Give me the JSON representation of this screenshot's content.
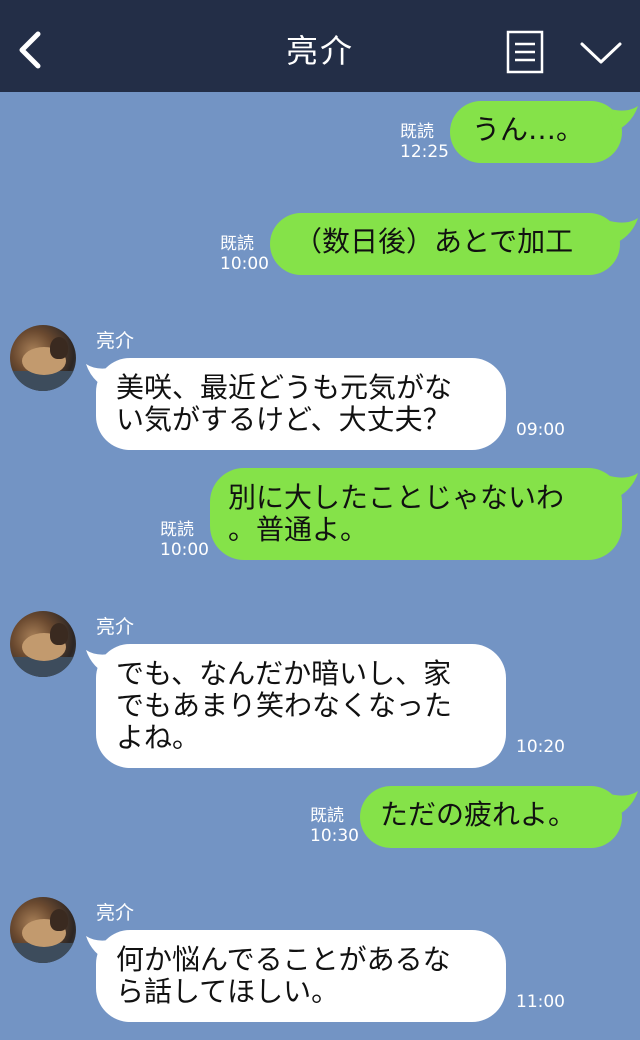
{
  "header": {
    "title": "亮介",
    "back_icon": "chevron-left-icon",
    "menu_icon": "note-icon",
    "dropdown_icon": "chevron-down-icon",
    "background": "#232e47"
  },
  "colors": {
    "chat_background": "#7394c4",
    "outgoing_bubble": "#85e249",
    "incoming_bubble": "#ffffff"
  },
  "messages": [
    {
      "from": "me",
      "text": "うん…。",
      "read": "既読",
      "time": "12:25"
    },
    {
      "from": "me",
      "text": "（数日後）あとで加工",
      "read": "既読",
      "time": "10:00"
    },
    {
      "from": "them",
      "sender": "亮介",
      "lines": [
        "美咲、最近どうも元気がな",
        "い気がするけど、大丈夫？"
      ],
      "time": "09:00"
    },
    {
      "from": "me",
      "lines": [
        "別に大したことじゃないわ",
        "。普通よ。"
      ],
      "read": "既読",
      "time": "10:00"
    },
    {
      "from": "them",
      "sender": "亮介",
      "lines": [
        "でも、なんだか暗いし、家",
        "でもあまり笑わなくなった",
        "よね。"
      ],
      "time": "10:20"
    },
    {
      "from": "me",
      "text": "ただの疲れよ。",
      "read": "既読",
      "time": "10:30"
    },
    {
      "from": "them",
      "sender": "亮介",
      "lines": [
        "何か悩んでることがあるな",
        "ら話してほしい。"
      ],
      "time": "11:00"
    }
  ]
}
